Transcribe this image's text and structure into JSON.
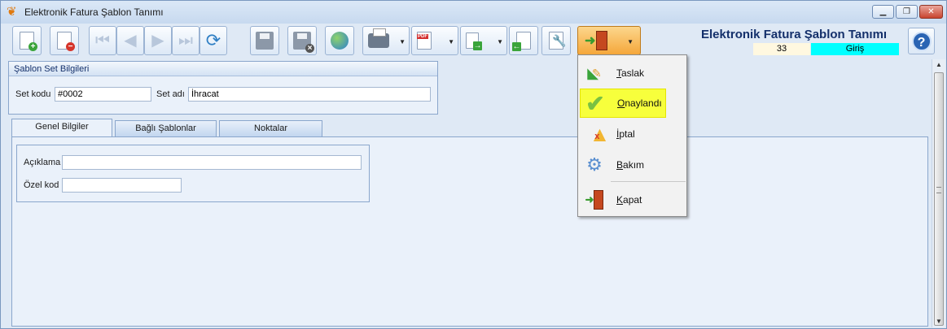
{
  "window": {
    "title": "Elektronik Fatura Şablon Tanımı",
    "controls": {
      "minimize": "▁",
      "restore": "❐",
      "close": "✕"
    }
  },
  "header": {
    "title": "Elektronik Fatura Şablon Tanımı",
    "number": "33",
    "status": "Giriş",
    "help": "?"
  },
  "toolbar": {
    "icons": [
      "new-document-icon",
      "delete-document-icon",
      "first-record-icon",
      "previous-record-icon",
      "next-record-icon",
      "last-record-icon",
      "refresh-icon",
      "save-icon",
      "save-close-icon",
      "web-icon",
      "print-icon",
      "pdf-export-icon",
      "copy-icon",
      "import-icon",
      "tools-icon",
      "exit-door-icon"
    ],
    "nav": {
      "first": "⏮",
      "prev": "◀",
      "next": "▶",
      "last": "⏭",
      "refresh": "⟳"
    },
    "pdf": "PDF"
  },
  "set_group": {
    "title": "Şablon Set Bilgileri",
    "code_label": "Set kodu",
    "code_value": "#0002",
    "name_label": "Set adı",
    "name_value": "İhracat"
  },
  "tabs": [
    "Genel Bilgiler",
    "Bağlı Şablonlar",
    "Noktalar"
  ],
  "general": {
    "description_label": "Açıklama",
    "description_value": "",
    "special_code_label": "Özel kod",
    "special_code_value": "",
    "ellipsis": "···"
  },
  "menu": {
    "items": [
      {
        "first": "T",
        "rest": "aslak",
        "icon": "draft-pencil-icon"
      },
      {
        "first": "O",
        "rest": "naylandı",
        "icon": "checkmark-icon"
      },
      {
        "first": "İ",
        "rest": "ptal",
        "icon": "warning-cancel-icon"
      },
      {
        "first": "B",
        "rest": "akım",
        "icon": "maintenance-gear-icon"
      },
      {
        "first": "K",
        "rest": "apat",
        "icon": "exit-door-icon"
      }
    ],
    "highlight_color": "#f7ff3c"
  },
  "colors": {
    "status_bg": "#00ffff",
    "number_bg": "#fff8e0",
    "title": "#14306b",
    "active_button": "#f5a73a"
  }
}
